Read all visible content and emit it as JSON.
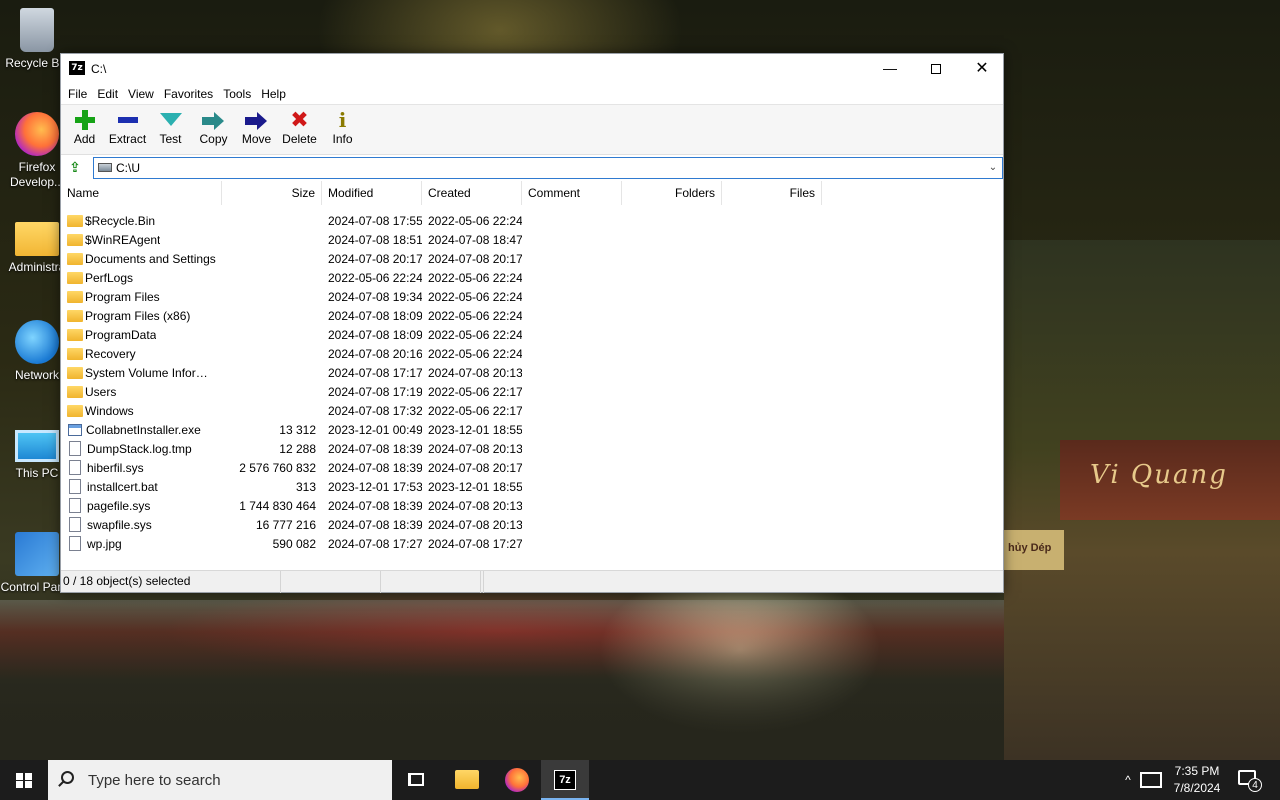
{
  "desktop": {
    "icons": [
      {
        "label": "Recycle Bin",
        "icon": "recycle-bin-icon"
      },
      {
        "label": "Firefox Develop...",
        "icon": "firefox-icon"
      },
      {
        "label": "Administra",
        "icon": "folder-icon"
      },
      {
        "label": "Network",
        "icon": "network-icon"
      },
      {
        "label": "This PC",
        "icon": "computer-icon"
      },
      {
        "label": "Control Panel",
        "icon": "control-panel-icon"
      }
    ],
    "wallpaper_sign": "Vi Quang",
    "wallpaper_shop": "hủy Dép"
  },
  "window": {
    "app_icon": "7z",
    "title": "C:\\",
    "menu": [
      "File",
      "Edit",
      "View",
      "Favorites",
      "Tools",
      "Help"
    ],
    "toolbar": [
      {
        "label": "Add",
        "icon": "add-icon"
      },
      {
        "label": "Extract",
        "icon": "extract-icon"
      },
      {
        "label": "Test",
        "icon": "test-icon"
      },
      {
        "label": "Copy",
        "icon": "copy-icon"
      },
      {
        "label": "Move",
        "icon": "move-icon"
      },
      {
        "label": "Delete",
        "icon": "delete-icon"
      },
      {
        "label": "Info",
        "icon": "info-icon"
      }
    ],
    "address": "C:\\U",
    "columns": [
      "Name",
      "Size",
      "Modified",
      "Created",
      "Comment",
      "Folders",
      "Files"
    ],
    "rows": [
      {
        "name": "$Recycle.Bin",
        "type": "folder",
        "size": "",
        "modified": "2024-07-08 17:55",
        "created": "2022-05-06 22:24"
      },
      {
        "name": "$WinREAgent",
        "type": "folder",
        "size": "",
        "modified": "2024-07-08 18:51",
        "created": "2024-07-08 18:47"
      },
      {
        "name": "Documents and Settings",
        "type": "folder",
        "size": "",
        "modified": "2024-07-08 20:17",
        "created": "2024-07-08 20:17"
      },
      {
        "name": "PerfLogs",
        "type": "folder",
        "size": "",
        "modified": "2022-05-06 22:24",
        "created": "2022-05-06 22:24"
      },
      {
        "name": "Program Files",
        "type": "folder",
        "size": "",
        "modified": "2024-07-08 19:34",
        "created": "2022-05-06 22:24"
      },
      {
        "name": "Program Files (x86)",
        "type": "folder",
        "size": "",
        "modified": "2024-07-08 18:09",
        "created": "2022-05-06 22:24"
      },
      {
        "name": "ProgramData",
        "type": "folder",
        "size": "",
        "modified": "2024-07-08 18:09",
        "created": "2022-05-06 22:24"
      },
      {
        "name": "Recovery",
        "type": "folder",
        "size": "",
        "modified": "2024-07-08 20:16",
        "created": "2022-05-06 22:24"
      },
      {
        "name": "System Volume Informa...",
        "type": "folder",
        "size": "",
        "modified": "2024-07-08 17:17",
        "created": "2024-07-08 20:13"
      },
      {
        "name": "Users",
        "type": "folder",
        "size": "",
        "modified": "2024-07-08 17:19",
        "created": "2022-05-06 22:17"
      },
      {
        "name": "Windows",
        "type": "folder",
        "size": "",
        "modified": "2024-07-08 17:32",
        "created": "2022-05-06 22:17"
      },
      {
        "name": "CollabnetInstaller.exe",
        "type": "exe",
        "size": "13 312",
        "modified": "2023-12-01 00:49",
        "created": "2023-12-01 18:55"
      },
      {
        "name": "DumpStack.log.tmp",
        "type": "file",
        "size": "12 288",
        "modified": "2024-07-08 18:39",
        "created": "2024-07-08 20:13"
      },
      {
        "name": "hiberfil.sys",
        "type": "file",
        "size": "2 576 760 832",
        "modified": "2024-07-08 18:39",
        "created": "2024-07-08 20:17"
      },
      {
        "name": "installcert.bat",
        "type": "file",
        "size": "313",
        "modified": "2023-12-01 17:53",
        "created": "2023-12-01 18:55"
      },
      {
        "name": "pagefile.sys",
        "type": "file",
        "size": "1 744 830 464",
        "modified": "2024-07-08 18:39",
        "created": "2024-07-08 20:13"
      },
      {
        "name": "swapfile.sys",
        "type": "file",
        "size": "16 777 216",
        "modified": "2024-07-08 18:39",
        "created": "2024-07-08 20:13"
      },
      {
        "name": "wp.jpg",
        "type": "file",
        "size": "590 082",
        "modified": "2024-07-08 17:27",
        "created": "2024-07-08 17:27"
      }
    ],
    "status": [
      "0 / 18 object(s) selected",
      "",
      "",
      ""
    ]
  },
  "taskbar": {
    "search_placeholder": "Type here to search",
    "time": "7:35 PM",
    "date": "7/8/2024",
    "notification_count": "4",
    "tray_chevron": "^"
  }
}
